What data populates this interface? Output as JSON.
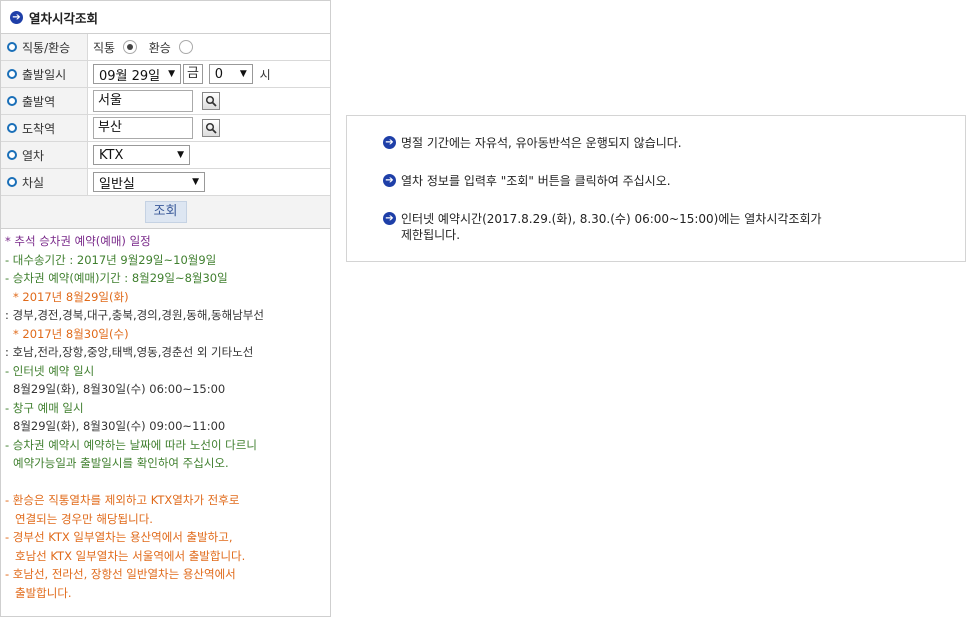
{
  "panel": {
    "title": "열차시각조회",
    "direct_label": "직통/환승",
    "direct_opt": "직통",
    "transfer_opt": "환승",
    "depart_dt_label": "출발일시",
    "date_value": "09월 29일",
    "day_value": "금",
    "hour_value": "0",
    "hour_unit": "시",
    "from_label": "출발역",
    "from_value": "서울",
    "to_label": "도착역",
    "to_value": "부산",
    "train_label": "열차",
    "train_value": "KTX",
    "class_label": "차실",
    "class_value": "일반실",
    "lookup_btn": "조회"
  },
  "notes": {
    "l1": "* 추석 승차권 예약(예매) 일정",
    "l2": "- 대수송기간 : 2017년 9월29일~10월9일",
    "l3": "- 승차권 예약(예매)기간 : 8월29일~8월30일",
    "l4": "* 2017년 8월29일(화)",
    "l5": ": 경부,경전,경북,대구,충북,경의,경원,동해,동해남부선",
    "l6": "* 2017년 8월30일(수)",
    "l7": ": 호남,전라,장항,중앙,태백,영동,경춘선 외 기타노선",
    "l8": "- 인터넷 예약 일시",
    "l9": "8월29일(화), 8월30일(수) 06:00~15:00",
    "l10": "- 창구 예매 일시",
    "l11": "8월29일(화), 8월30일(수) 09:00~11:00",
    "l12": "- 승차권 예약시 예약하는 날짜에 따라 노선이 다르니",
    "l13": "예약가능일과 출발일시를 확인하여 주십시오.",
    "l14": "- 환승은 직통열차를 제외하고 KTX열차가 전후로",
    "l15": "연결되는 경우만 해당됩니다.",
    "l16": "- 경부선 KTX 일부열차는 용산역에서 출발하고,",
    "l17": "호남선 KTX 일부열차는 서울역에서 출발합니다.",
    "l18": "- 호남선, 전라선, 장항선 일반열차는 용산역에서",
    "l19": "출발합니다."
  },
  "info": {
    "m1": "명절 기간에는 자유석, 유아동반석은 운행되지 않습니다.",
    "m2": "열차 정보를 입력후 \"조회\" 버튼을 클릭하여 주십시오.",
    "m3a": "인터넷 예약시간(2017.8.29.(화), 8.30.(수) 06:00~15:00)에는 열차시각조회가",
    "m3b": "제한됩니다."
  },
  "icons": {
    "arrow": "arrow-circle-icon",
    "search": "magnifier-icon",
    "dropdown": "triangle-down-icon"
  },
  "colors": {
    "accent": "#1e3fa8",
    "purple": "#7a2a8a",
    "green": "#3f7f2e",
    "orange": "#e06a1a"
  }
}
